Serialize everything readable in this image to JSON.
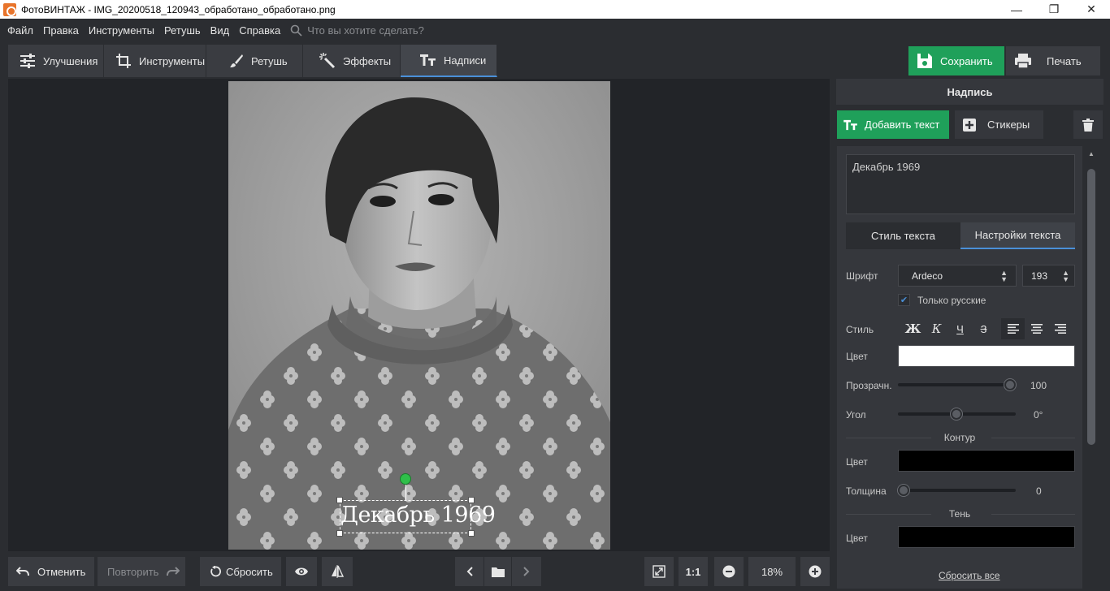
{
  "window": {
    "title": "ФотоВИНТАЖ - IMG_20200518_120943_обработано_обработано.png",
    "controls": [
      "—",
      "❐",
      "✕"
    ]
  },
  "menu": {
    "items": [
      "Файл",
      "Правка",
      "Инструменты",
      "Ретушь",
      "Вид",
      "Справка"
    ],
    "search_placeholder": "Что вы хотите сделать?"
  },
  "tabs": [
    {
      "label": "Улучшения",
      "icon": "sliders-icon"
    },
    {
      "label": "Инструменты",
      "icon": "crop-icon"
    },
    {
      "label": "Ретушь",
      "icon": "brush-icon"
    },
    {
      "label": "Эффекты",
      "icon": "magic-wand-icon"
    },
    {
      "label": "Надписи",
      "icon": "text-icon",
      "active": true
    }
  ],
  "toolbar": {
    "save_label": "Сохранить",
    "print_label": "Печать"
  },
  "canvas": {
    "caption_text": "Декабрь 1969"
  },
  "panel": {
    "title": "Надпись",
    "add_text_label": "Добавить текст",
    "stickers_label": "Стикеры",
    "text_value": "Декабрь 1969",
    "subtabs": [
      "Стиль текста",
      "Настройки текста"
    ],
    "active_subtab": 1,
    "font": {
      "label": "Шрифт",
      "value": "Ardeco",
      "size": "193",
      "only_russian_label": "Только русские",
      "only_russian_checked": true
    },
    "style": {
      "label": "Стиль",
      "bold": "Ж",
      "italic": "К",
      "underline": "Ч",
      "strike": "З",
      "alignment": "left"
    },
    "color": {
      "label": "Цвет",
      "value": "#ffffff"
    },
    "opacity": {
      "label": "Прозрачн.",
      "value": "100",
      "fraction": 1.0
    },
    "angle": {
      "label": "Угол",
      "value": "0°",
      "fraction": 0.5
    },
    "outline": {
      "title": "Контур",
      "color_label": "Цвет",
      "color": "#000000",
      "thickness_label": "Толщина",
      "thickness_value": "0",
      "fraction": 0.0
    },
    "shadow": {
      "title": "Тень",
      "color_label": "Цвет",
      "color": "#000000"
    },
    "reset_all_label": "Сбросить все"
  },
  "bottom": {
    "undo_label": "Отменить",
    "redo_label": "Повторить",
    "reset_label": "Сбросить",
    "one_to_one_label": "1:1",
    "zoom_value": "18%"
  },
  "colors": {
    "accent_green": "#1fa05a",
    "accent_blue": "#4a90d9",
    "background": "#2b2d31"
  }
}
